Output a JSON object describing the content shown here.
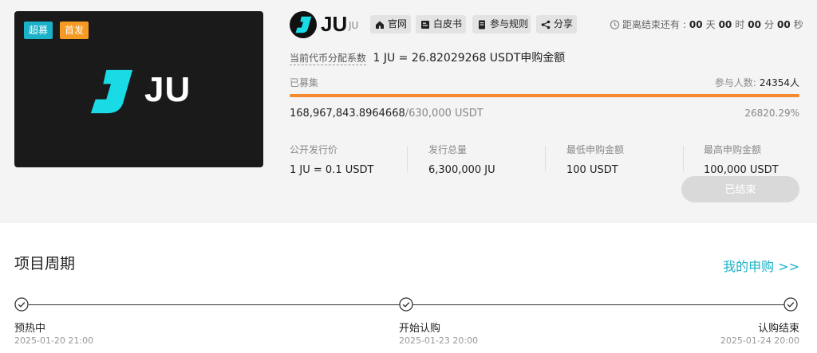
{
  "banner": {
    "tag_super": "超募",
    "tag_first": "首发",
    "brand_text": "JU",
    "colors": {
      "background": "#1a1a1a",
      "icon": "#18dbe5",
      "tag_super": "#1ab1c9",
      "tag_first": "#f59a23"
    }
  },
  "token": {
    "name": "JU",
    "sub": "JU",
    "logo": "ju-logo-icon"
  },
  "links": [
    {
      "label": "官网",
      "icon": "home-icon"
    },
    {
      "label": "白皮书",
      "icon": "book-icon"
    },
    {
      "label": "参与规则",
      "icon": "document-icon"
    },
    {
      "label": "分享",
      "icon": "share-icon"
    }
  ],
  "countdown": {
    "label": "距离结束还有 :",
    "days": "00",
    "days_unit": "天",
    "hours": "00",
    "hours_unit": "时",
    "minutes": "00",
    "minutes_unit": "分",
    "seconds": "00",
    "seconds_unit": "秒"
  },
  "ratio": {
    "label": "当前代币分配系数",
    "value": "1 JU = 26.82029268 USDT申购金额"
  },
  "progress": {
    "raised_label": "已募集",
    "participants_label": "参与人数:",
    "participants": "24354人",
    "raised_amount": "168,967,843.8964668",
    "target_amount": "/630,000 USDT",
    "percent_text": "26820.29%",
    "fill_fraction": 1.0,
    "bar_color": "#f58b2e"
  },
  "stats": [
    {
      "label": "公开发行价",
      "value": "1 JU = 0.1 USDT"
    },
    {
      "label": "发行总量",
      "value": "6,300,000 JU"
    },
    {
      "label": "最低申购金额",
      "value": "100 USDT"
    },
    {
      "label": "最高申购金额",
      "value": "100,000 USDT"
    }
  ],
  "action": {
    "label": "已结束"
  },
  "cycle": {
    "title": "项目周期",
    "my_link": "我的申购 >>",
    "accent": "#1ab1c9",
    "steps": [
      {
        "name": "预热中",
        "date": "2025-01-20 21:00"
      },
      {
        "name": "开始认购",
        "date": "2025-01-23 20:00"
      },
      {
        "name": "认购结束",
        "date": "2025-01-24 20:00"
      }
    ]
  }
}
